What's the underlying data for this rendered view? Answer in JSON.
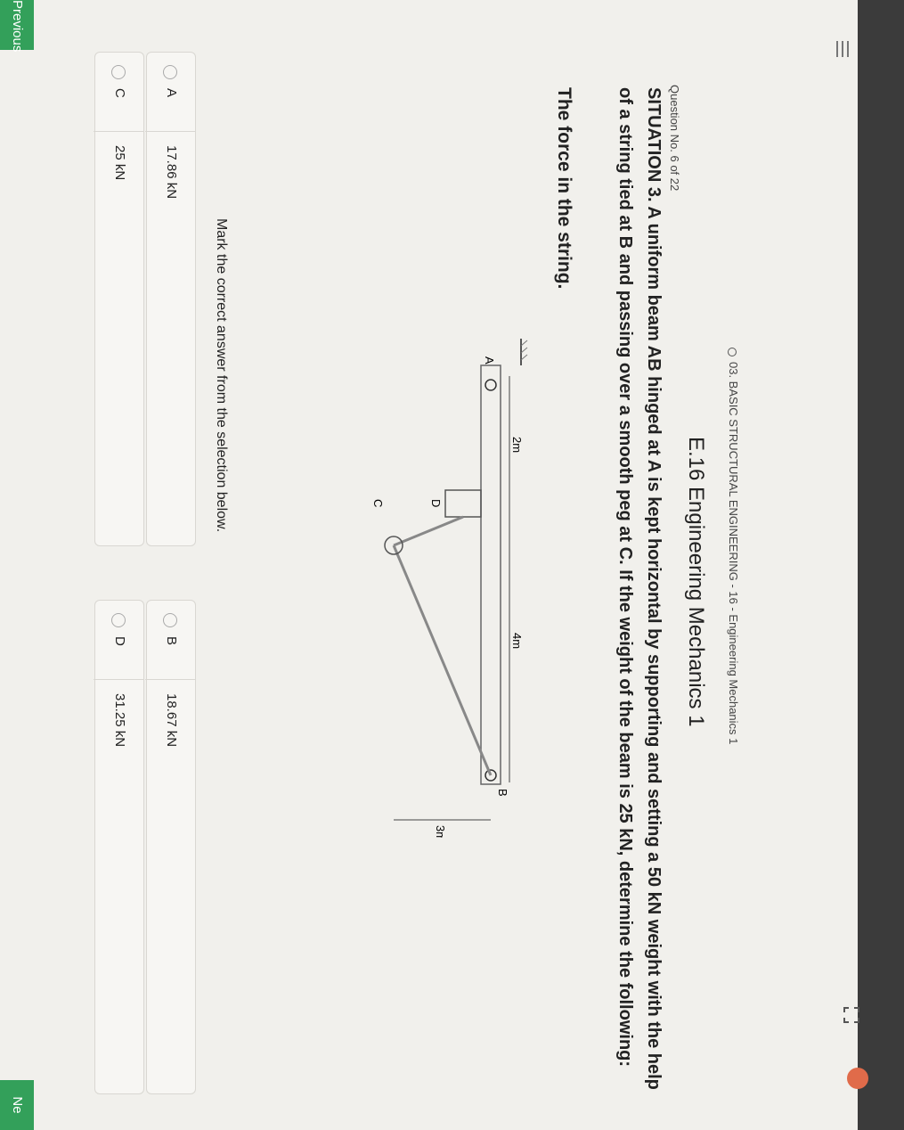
{
  "header": {
    "breadcrumb": "03. BASIC STRUCTURAL ENGINEERING - 16 - Engineering Mechanics 1"
  },
  "question": {
    "number": "Question No. 6 of 22",
    "course_title": "E.16 Engineering Mechanics 1",
    "situation": "SITUATION 3. A uniform beam AB hinged at A is kept horizontal by supporting and setting a 50 kN weight with the help of a string tied at B and passing over a smooth peg at C. If the weight of the beam is 25 kN, determine the following:",
    "prompt": "The force in the string."
  },
  "figure": {
    "label_a": "A",
    "label_b": "B",
    "label_c": "C",
    "label_d": "D",
    "dim_2m": "2m",
    "dim_4m": "4m",
    "dim_3m": "3m"
  },
  "instruction": "Mark the correct answer from the selection below.",
  "options": [
    {
      "letter": "A",
      "value": "17.86 kN"
    },
    {
      "letter": "B",
      "value": "18.67 kN"
    },
    {
      "letter": "C",
      "value": "25 kN"
    },
    {
      "letter": "D",
      "value": "31.25 kN"
    }
  ],
  "footer": {
    "previous_label": "Previous",
    "next_label": "Ne"
  },
  "icons": [
    "menu-icon",
    "expand-icon",
    "avatar"
  ],
  "colors": {
    "accent": "#33a05a",
    "topbar": "#3b3b3b",
    "avatar": "#e06b4a"
  }
}
